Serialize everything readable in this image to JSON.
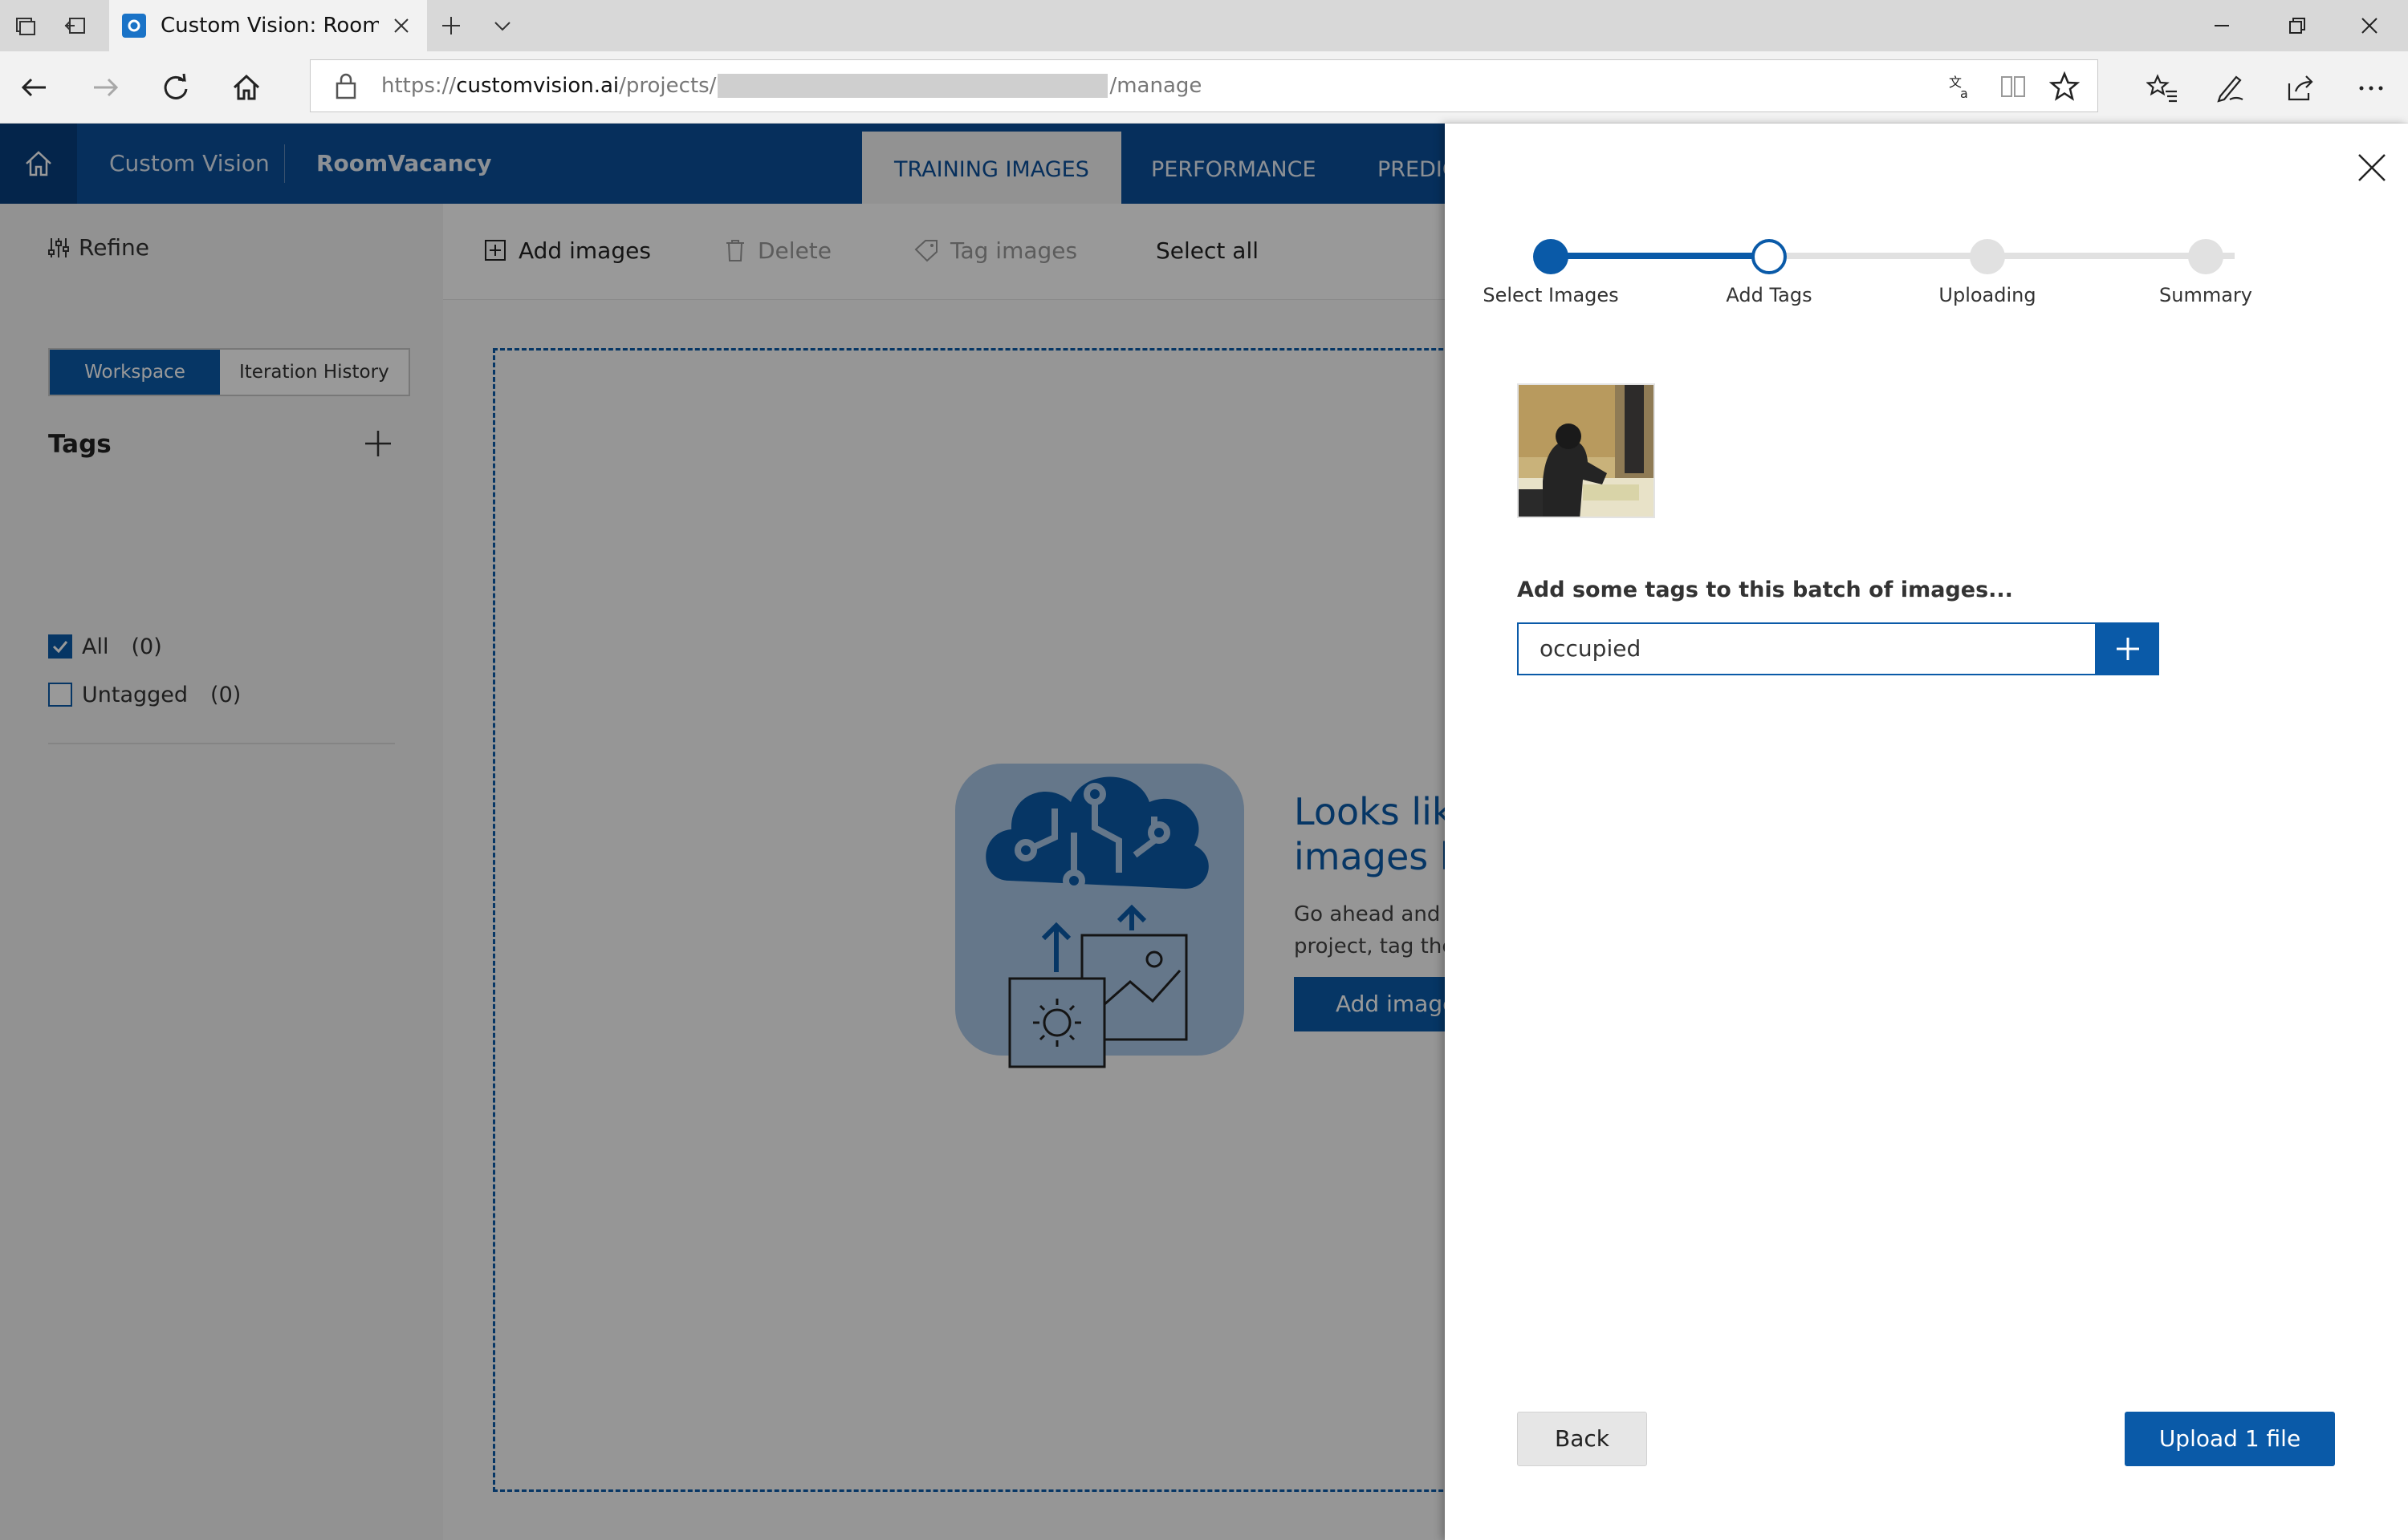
{
  "browser": {
    "tab_title": "Custom Vision: RoomVa",
    "url_prefix": "https://",
    "url_host": "customvision.ai",
    "url_path1": "/projects/",
    "url_path2": "/manage"
  },
  "app": {
    "brand": "Custom Vision",
    "project": "RoomVacancy",
    "tabs": [
      {
        "label": "TRAINING IMAGES",
        "active": true
      },
      {
        "label": "PERFORMANCE",
        "active": false
      },
      {
        "label": "PREDIC",
        "active": false
      }
    ]
  },
  "sidebar": {
    "refine_label": "Refine",
    "segments": {
      "workspace": "Workspace",
      "iteration_history": "Iteration History"
    },
    "tags_heading": "Tags",
    "tag_items": [
      {
        "label": "All",
        "count": "(0)",
        "checked": true
      },
      {
        "label": "Untagged",
        "count": "(0)",
        "checked": false
      }
    ]
  },
  "toolbar": {
    "add_images": "Add images",
    "delete": "Delete",
    "tag_images": "Tag images",
    "select_all": "Select all"
  },
  "empty_state": {
    "title_line1": "Looks like",
    "title_line2": "images h",
    "desc_line1": "Go ahead and b",
    "desc_line2": "project, tag the",
    "button": "Add images"
  },
  "panel": {
    "steps": [
      {
        "label": "Select Images",
        "state": "done"
      },
      {
        "label": "Add Tags",
        "state": "current"
      },
      {
        "label": "Uploading",
        "state": "pending"
      },
      {
        "label": "Summary",
        "state": "pending"
      }
    ],
    "tags_prompt": "Add some tags to this batch of images...",
    "tag_input_value": "occupied",
    "back_label": "Back",
    "upload_label": "Upload 1 file"
  },
  "colors": {
    "accent": "#0a5aa8",
    "nav_bg": "#0a4f9a"
  }
}
